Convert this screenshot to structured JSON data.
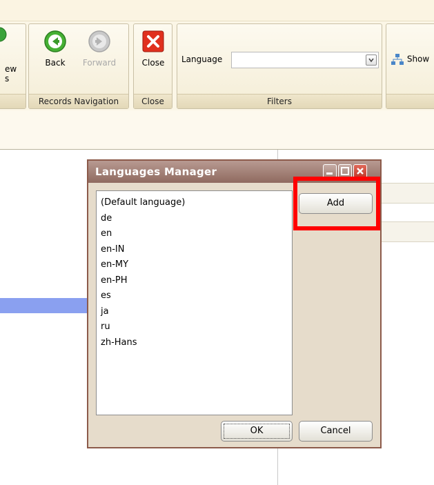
{
  "ribbon": {
    "view_fragment": {
      "line1": "ew",
      "line2": "s"
    },
    "back_label": "Back",
    "forward_label": "Forward",
    "close_label": "Close",
    "language_label": "Language",
    "language_value": "",
    "show_label": "Show",
    "groups": {
      "records_navigation": "Records Navigation",
      "close": "Close",
      "filters": "Filters"
    }
  },
  "dialog": {
    "title": "Languages Manager",
    "languages": [
      "(Default language)",
      "de",
      "en",
      "en-IN",
      "en-MY",
      "en-PH",
      "es",
      "ja",
      "ru",
      "zh-Hans"
    ],
    "add_label": "Add",
    "ok_label": "OK",
    "cancel_label": "Cancel"
  },
  "colors": {
    "highlight": "#ff0000",
    "titlebar": "#8f6a5f",
    "selected_row": "#8aa0f0"
  }
}
